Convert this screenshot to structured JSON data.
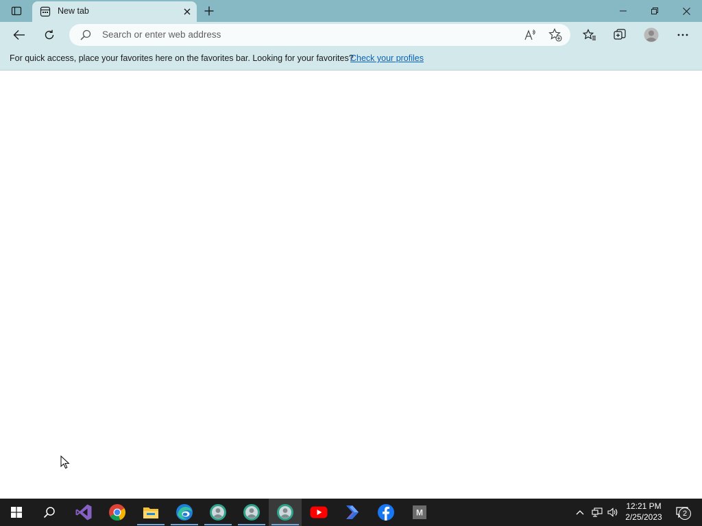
{
  "tabs": [
    {
      "title": "New tab",
      "icon": "new-tab-page-icon",
      "active": true
    }
  ],
  "toolbar": {
    "search_placeholder": "Search or enter web address"
  },
  "favorites_bar": {
    "message": "For quick access, place your favorites here on the favorites bar. Looking for your favorites?",
    "link": "Check your profiles"
  },
  "taskbar": {
    "apps": [
      {
        "name": "visual-studio-icon"
      },
      {
        "name": "chrome-icon"
      },
      {
        "name": "file-explorer-icon"
      },
      {
        "name": "edge-icon"
      },
      {
        "name": "edge-profile-icon"
      },
      {
        "name": "edge-profile-icon"
      },
      {
        "name": "edge-profile-icon"
      },
      {
        "name": "youtube-icon"
      },
      {
        "name": "power-automate-icon"
      },
      {
        "name": "facebook-icon"
      },
      {
        "name": "m-app-icon",
        "letter": "M"
      }
    ],
    "clock": {
      "time": "12:21 PM",
      "date": "2/25/2023"
    },
    "notifications": "2"
  },
  "colors": {
    "titlebar": "#86b9c4",
    "toolbar": "#d3e8eb",
    "taskbar": "#1c1c1c",
    "link": "#0b62b4"
  }
}
